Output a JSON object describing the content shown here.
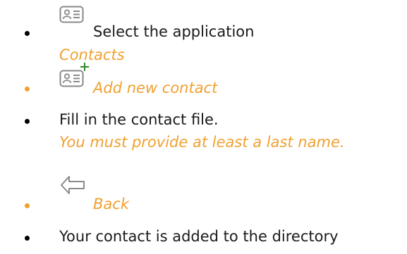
{
  "colors": {
    "accent": "#f0a030",
    "text": "#1a1a1a",
    "icon": "#7a7a7a"
  },
  "steps": [
    {
      "icon": "contacts-app-icon",
      "text": "Select the application",
      "subtext": "Contacts"
    },
    {
      "icon": "add-contact-icon",
      "text": "Add new contact"
    },
    {
      "text": "Fill in the contact file.",
      "subtext": "You must provide at least a last name."
    },
    {
      "icon": "back-arrow-icon",
      "text": "Back"
    },
    {
      "text": "Your contact is added to the directory"
    }
  ]
}
